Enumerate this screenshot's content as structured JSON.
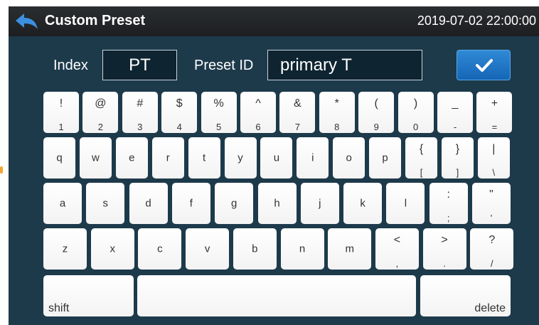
{
  "header": {
    "title": "Custom Preset",
    "datetime": "2019-07-02  22:00:00",
    "back_icon": "back-arrow-icon"
  },
  "form": {
    "index_label": "Index",
    "index_value": "PT",
    "preset_id_label": "Preset ID",
    "preset_id_value": "primary T",
    "confirm_icon": "check-icon"
  },
  "keyboard": {
    "row1": [
      {
        "top": "!",
        "bot": "1"
      },
      {
        "top": "@",
        "bot": "2"
      },
      {
        "top": "#",
        "bot": "3"
      },
      {
        "top": "$",
        "bot": "4"
      },
      {
        "top": "%",
        "bot": "5"
      },
      {
        "top": "^",
        "bot": "6"
      },
      {
        "top": "&",
        "bot": "7"
      },
      {
        "top": "*",
        "bot": "8"
      },
      {
        "top": "(",
        "bot": "9"
      },
      {
        "top": ")",
        "bot": "0"
      },
      {
        "top": "_",
        "bot": "-"
      },
      {
        "top": "+",
        "bot": "="
      }
    ],
    "row2": [
      {
        "top": "",
        "bot": "",
        "mid": "q"
      },
      {
        "top": "",
        "bot": "",
        "mid": "w"
      },
      {
        "top": "",
        "bot": "",
        "mid": "e"
      },
      {
        "top": "",
        "bot": "",
        "mid": "r"
      },
      {
        "top": "",
        "bot": "",
        "mid": "t"
      },
      {
        "top": "",
        "bot": "",
        "mid": "y"
      },
      {
        "top": "",
        "bot": "",
        "mid": "u"
      },
      {
        "top": "",
        "bot": "",
        "mid": "i"
      },
      {
        "top": "",
        "bot": "",
        "mid": "o"
      },
      {
        "top": "",
        "bot": "",
        "mid": "p"
      },
      {
        "top": "{",
        "bot": "["
      },
      {
        "top": "}",
        "bot": "]"
      },
      {
        "top": "|",
        "bot": "\\"
      }
    ],
    "row3": [
      {
        "top": "",
        "bot": "",
        "mid": "a"
      },
      {
        "top": "",
        "bot": "",
        "mid": "s"
      },
      {
        "top": "",
        "bot": "",
        "mid": "d"
      },
      {
        "top": "",
        "bot": "",
        "mid": "f"
      },
      {
        "top": "",
        "bot": "",
        "mid": "g"
      },
      {
        "top": "",
        "bot": "",
        "mid": "h"
      },
      {
        "top": "",
        "bot": "",
        "mid": "j"
      },
      {
        "top": "",
        "bot": "",
        "mid": "k"
      },
      {
        "top": "",
        "bot": "",
        "mid": "l"
      },
      {
        "top": ":",
        "bot": ";"
      },
      {
        "top": "\"",
        "bot": "'"
      }
    ],
    "row4": [
      {
        "top": "",
        "bot": "",
        "mid": "z"
      },
      {
        "top": "",
        "bot": "",
        "mid": "x"
      },
      {
        "top": "",
        "bot": "",
        "mid": "c"
      },
      {
        "top": "",
        "bot": "",
        "mid": "v"
      },
      {
        "top": "",
        "bot": "",
        "mid": "b"
      },
      {
        "top": "",
        "bot": "",
        "mid": "n"
      },
      {
        "top": "",
        "bot": "",
        "mid": "m"
      },
      {
        "top": "<",
        "bot": ","
      },
      {
        "top": ">",
        "bot": "."
      },
      {
        "top": "?",
        "bot": "/"
      }
    ],
    "shift_label": "shift",
    "delete_label": "delete"
  },
  "colors": {
    "background": "#1d3a4b",
    "titlebar": "#24272a",
    "confirm": "#1f78c8",
    "key": "#ffffff",
    "back_arrow": "#3b8fe0"
  }
}
